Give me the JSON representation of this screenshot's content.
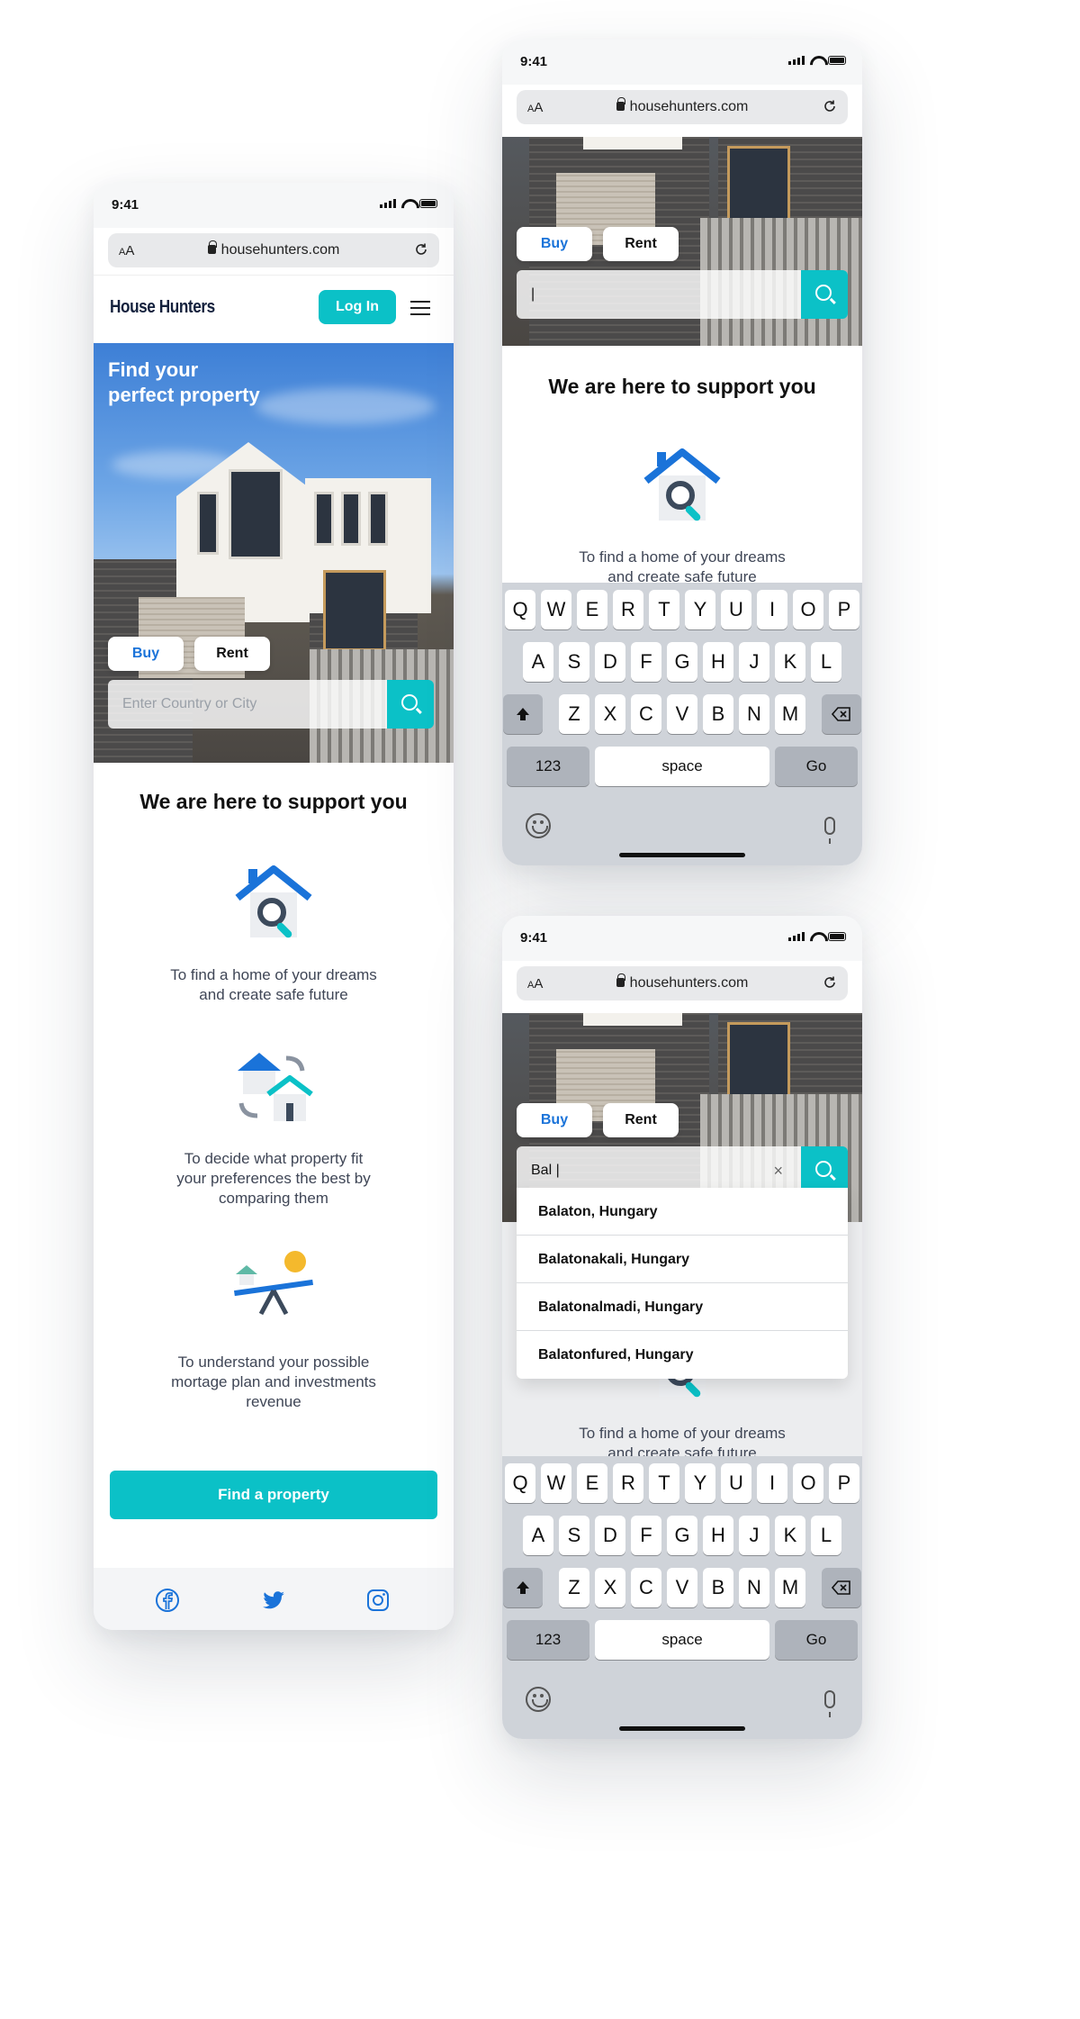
{
  "status": {
    "time": "9:41"
  },
  "browser": {
    "aa_label": "A",
    "aa_big": "A",
    "url": "househunters.com"
  },
  "header": {
    "logo": "House Hunters",
    "login_label": "Log In"
  },
  "hero": {
    "title_line1": "Find your",
    "title_line2": "perfect property"
  },
  "tabs": {
    "buy": "Buy",
    "rent": "Rent"
  },
  "search": {
    "placeholder": "Enter Country or City",
    "typed_value": "Bal |",
    "cursor": "|",
    "clear": "×"
  },
  "support": {
    "title": "We are here to support you",
    "features": [
      {
        "icon": "house-search-icon",
        "line1": "To find a home of your dreams",
        "line2": "and create safe future",
        "line3": ""
      },
      {
        "icon": "compare-houses-icon",
        "line1": "To decide what property fit",
        "line2": "your preferences the best by",
        "line3": "comparing them"
      },
      {
        "icon": "mortgage-seesaw-icon",
        "line1": "To understand your possible",
        "line2": "mortage plan and investments",
        "line3": "revenue"
      }
    ],
    "cta": "Find a property"
  },
  "footer": {
    "icons": [
      "facebook-icon",
      "twitter-icon",
      "instagram-icon"
    ]
  },
  "keyboard": {
    "row1": [
      "Q",
      "W",
      "E",
      "R",
      "T",
      "Y",
      "U",
      "I",
      "O",
      "P"
    ],
    "row2": [
      "A",
      "S",
      "D",
      "F",
      "G",
      "H",
      "J",
      "K",
      "L"
    ],
    "row3": [
      "Z",
      "X",
      "C",
      "V",
      "B",
      "N",
      "M"
    ],
    "numbers": "123",
    "space": "space",
    "go": "Go"
  },
  "suggestions": [
    "Balaton, Hungary",
    "Balatonakali, Hungary",
    "Balatonalmadi, Hungary",
    "Balatonfured, Hungary"
  ],
  "colors": {
    "accent": "#0bc1c7",
    "buy_blue": "#1a73d9",
    "navy": "#14213d"
  }
}
